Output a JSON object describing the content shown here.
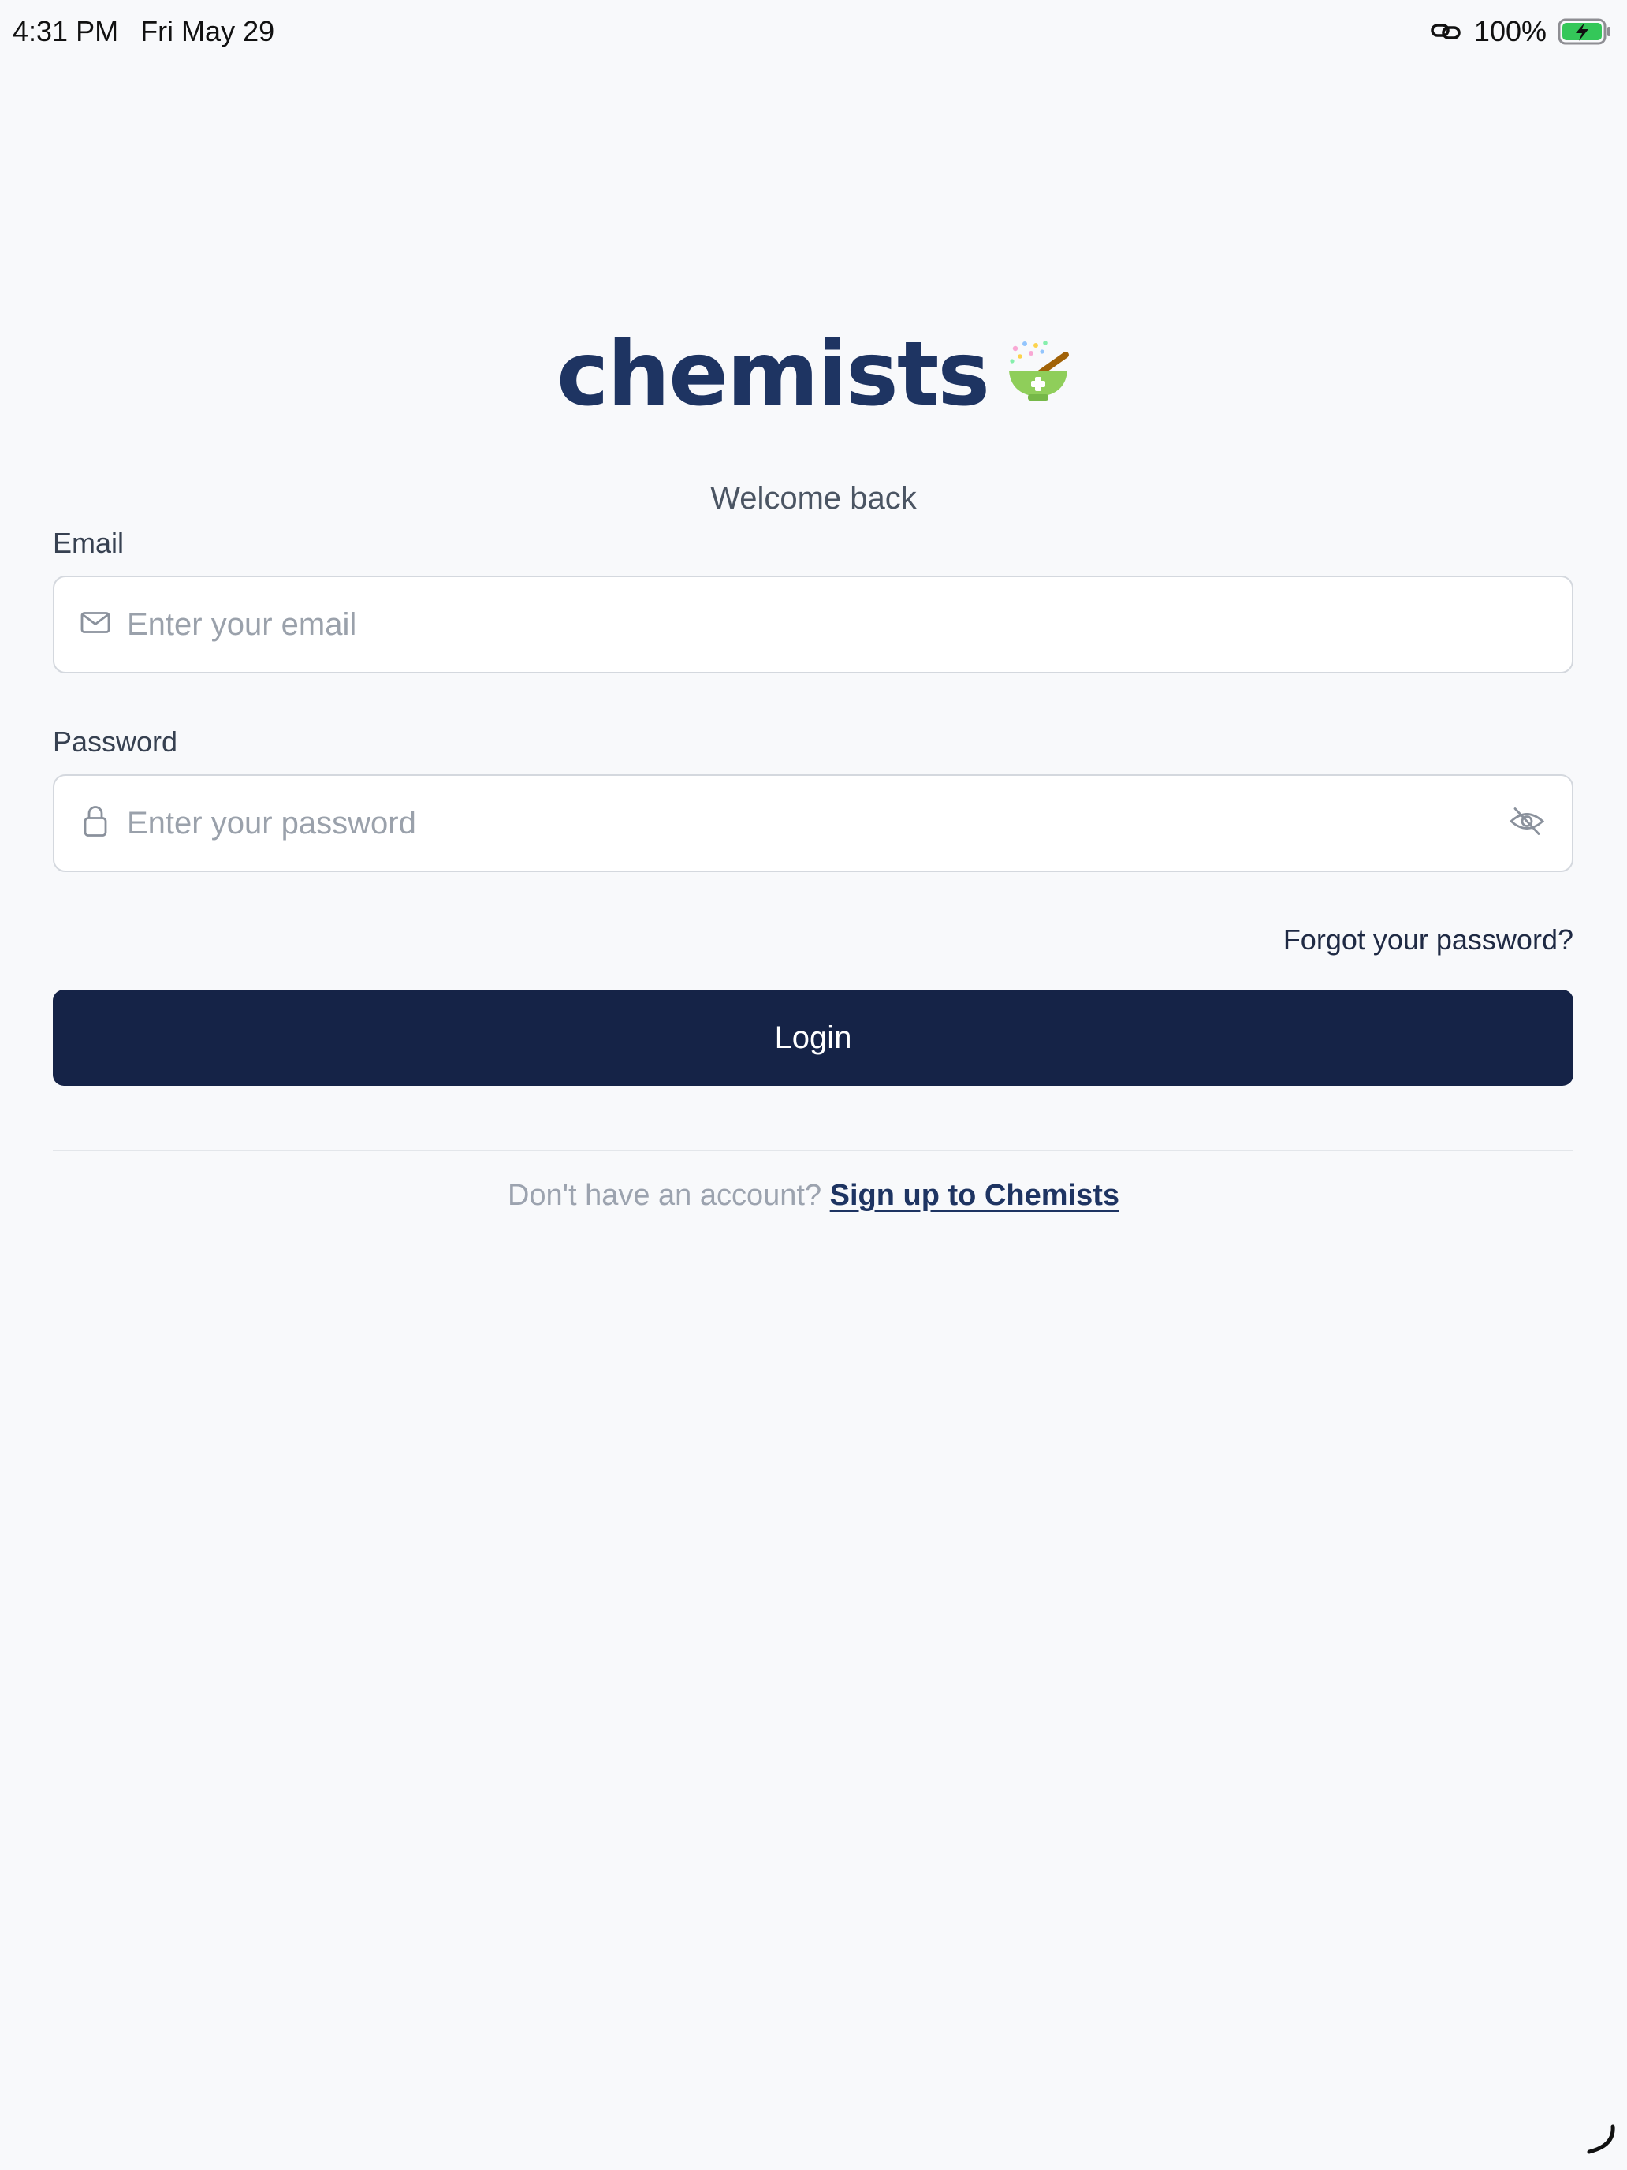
{
  "status_bar": {
    "time": "4:31 PM",
    "date": "Fri May 29",
    "battery": "100%",
    "battery_color": "#34c759"
  },
  "logo": {
    "text": "chemists",
    "icon": "mortar-pestle-icon",
    "text_color": "#1e3462"
  },
  "welcome": "Welcome back",
  "email": {
    "label": "Email",
    "placeholder": "Enter your email",
    "value": "",
    "icon": "mail-icon"
  },
  "password": {
    "label": "Password",
    "placeholder": "Enter your password",
    "value": "",
    "icon": "lock-icon",
    "toggle_icon": "eye-off-icon"
  },
  "forgot_password": "Forgot your password?",
  "login_button": "Login",
  "login_button_color": "#152347",
  "signup": {
    "prompt": "Don't have an account?",
    "link": "Sign up to Chemists"
  }
}
